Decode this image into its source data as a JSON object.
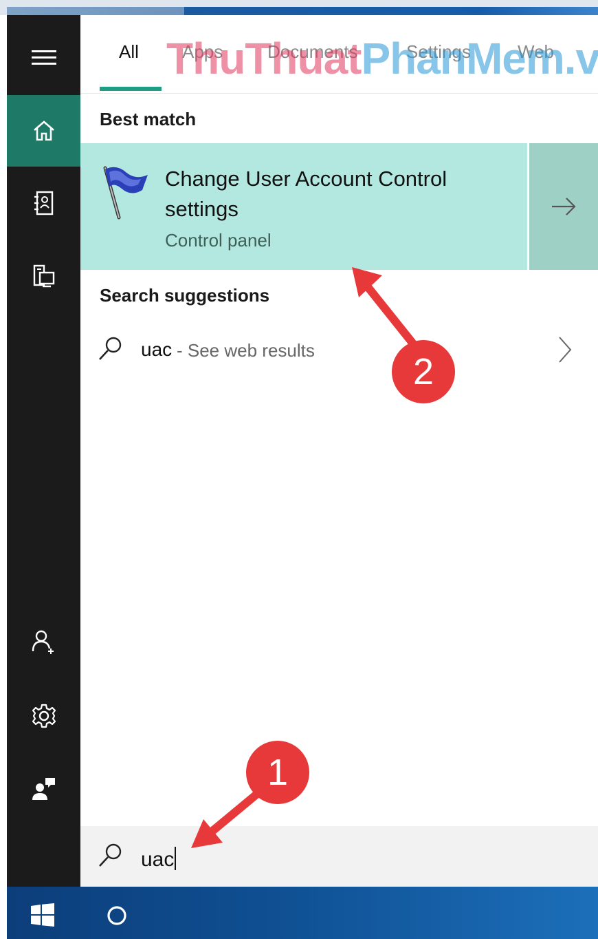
{
  "tabs": [
    {
      "label": "All",
      "active": true
    },
    {
      "label": "Apps"
    },
    {
      "label": "Documents"
    },
    {
      "label": "Settings"
    },
    {
      "label": "Web"
    }
  ],
  "watermark": {
    "part1": "ThuThuat",
    "part2": "PhanMem.vn"
  },
  "sections": {
    "best_match_title": "Best match",
    "suggestions_title": "Search suggestions"
  },
  "best_match": {
    "title": "Change User Account Control settings",
    "subtitle": "Control panel",
    "icon": "uac-flag-icon"
  },
  "suggestion": {
    "query": "uac",
    "hint": "- See web results"
  },
  "search": {
    "value": "uac"
  },
  "sidebar": {
    "items": [
      {
        "icon": "hamburger-menu-icon"
      },
      {
        "icon": "home-icon",
        "active": true
      },
      {
        "icon": "notebook-icon"
      },
      {
        "icon": "devices-icon"
      },
      {
        "icon": "add-user-icon"
      },
      {
        "icon": "gear-icon"
      },
      {
        "icon": "feedback-icon"
      }
    ]
  },
  "taskbar": {
    "start": "windows-logo-icon",
    "cortana": "cortana-circle-icon"
  },
  "annotations": [
    {
      "number": "1"
    },
    {
      "number": "2"
    }
  ],
  "colors": {
    "accent": "#1e9f85",
    "rail_active": "#1e7a67",
    "best_match_bg": "#b2e8df",
    "annotation_red": "#e8393a"
  }
}
